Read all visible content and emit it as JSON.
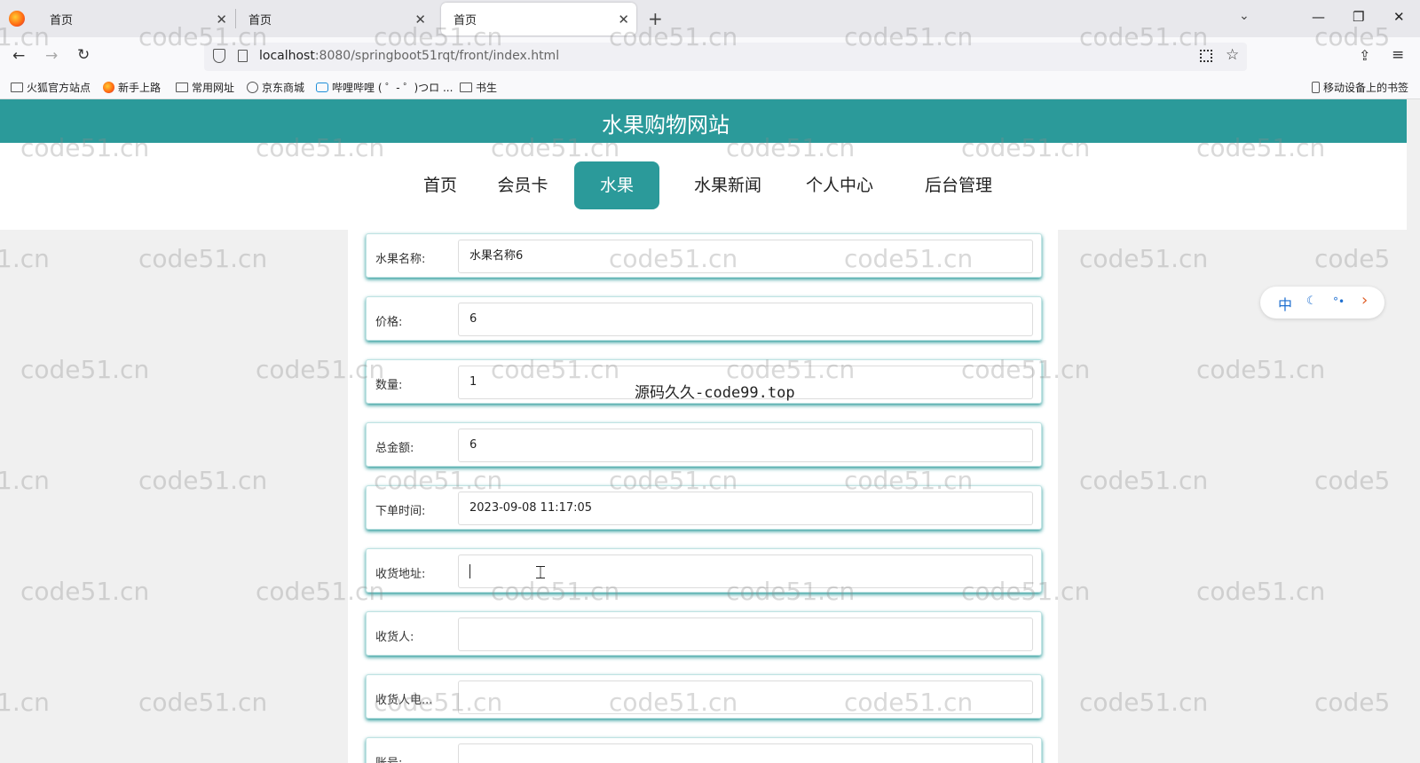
{
  "browser": {
    "tabs": [
      {
        "label": "首页"
      },
      {
        "label": "首页"
      },
      {
        "label": "首页"
      }
    ],
    "url": {
      "host": "localhost",
      "rest": ":8080/springboot51rqt/front/index.html"
    },
    "bookmarks": [
      "火狐官方站点",
      "新手上路",
      "常用网址",
      "京东商城",
      "哔哩哔哩 ( ゜- ゜)つロ ...",
      "书生"
    ],
    "mobile_bookmarks": "移动设备上的书签"
  },
  "site": {
    "title": "水果购物网站",
    "menu": [
      "首页",
      "会员卡",
      "水果",
      "水果新闻",
      "个人中心",
      "后台管理"
    ],
    "active_menu": "水果"
  },
  "form": {
    "rows": [
      {
        "label": "水果名称:",
        "value": "水果名称6"
      },
      {
        "label": "价格:",
        "value": "6"
      },
      {
        "label": "数量:",
        "value": "1"
      },
      {
        "label": "总金额:",
        "value": "6"
      },
      {
        "label": "下单时间:",
        "value": "2023-09-08 11:17:05"
      },
      {
        "label": "收货地址:",
        "value": ""
      },
      {
        "label": "收货人:",
        "value": ""
      },
      {
        "label": "收货人电...",
        "value": ""
      },
      {
        "label": "账号:",
        "value": ""
      }
    ]
  },
  "lang_widget": {
    "lang": "中"
  },
  "watermark": {
    "text": "code51.cn",
    "fragment": "1.cn",
    "fragment2": "code5",
    "center_overlay": "源码久久-code99.top"
  },
  "icons": {
    "back": "back-arrow-icon",
    "forward": "forward-arrow-icon",
    "reload": "reload-icon",
    "star": "bookmark-star-icon",
    "menu": "hamburger-menu-icon"
  }
}
